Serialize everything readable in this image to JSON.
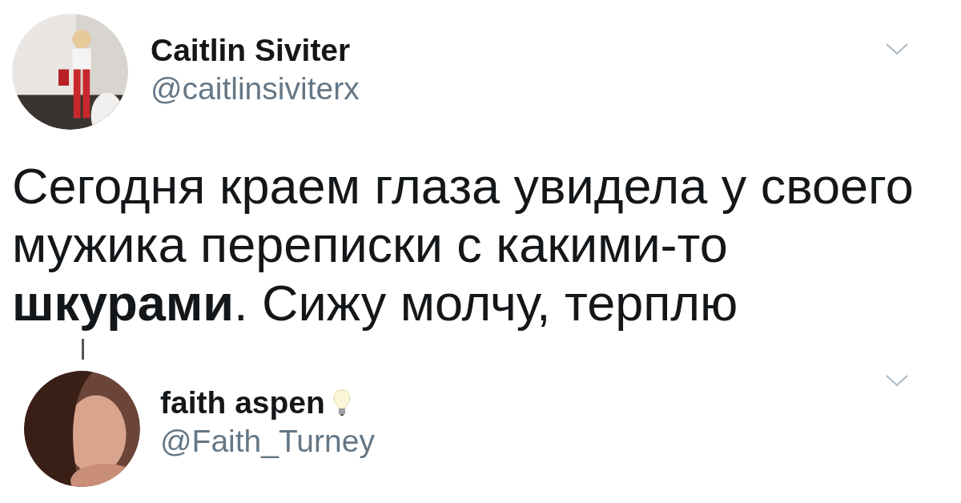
{
  "tweet": {
    "author": {
      "name": "Caitlin Siviter",
      "handle": "@caitlinsiviterx",
      "bulb_badge": false
    },
    "text": "Сегодня краем глаза увидела у своего мужика переписки с какими-то **шкурами**. Сижу молчу, терплю"
  },
  "reply": {
    "author": {
      "name": "faith aspen",
      "handle": "@Faith_Turney",
      "bulb_badge": true
    }
  }
}
